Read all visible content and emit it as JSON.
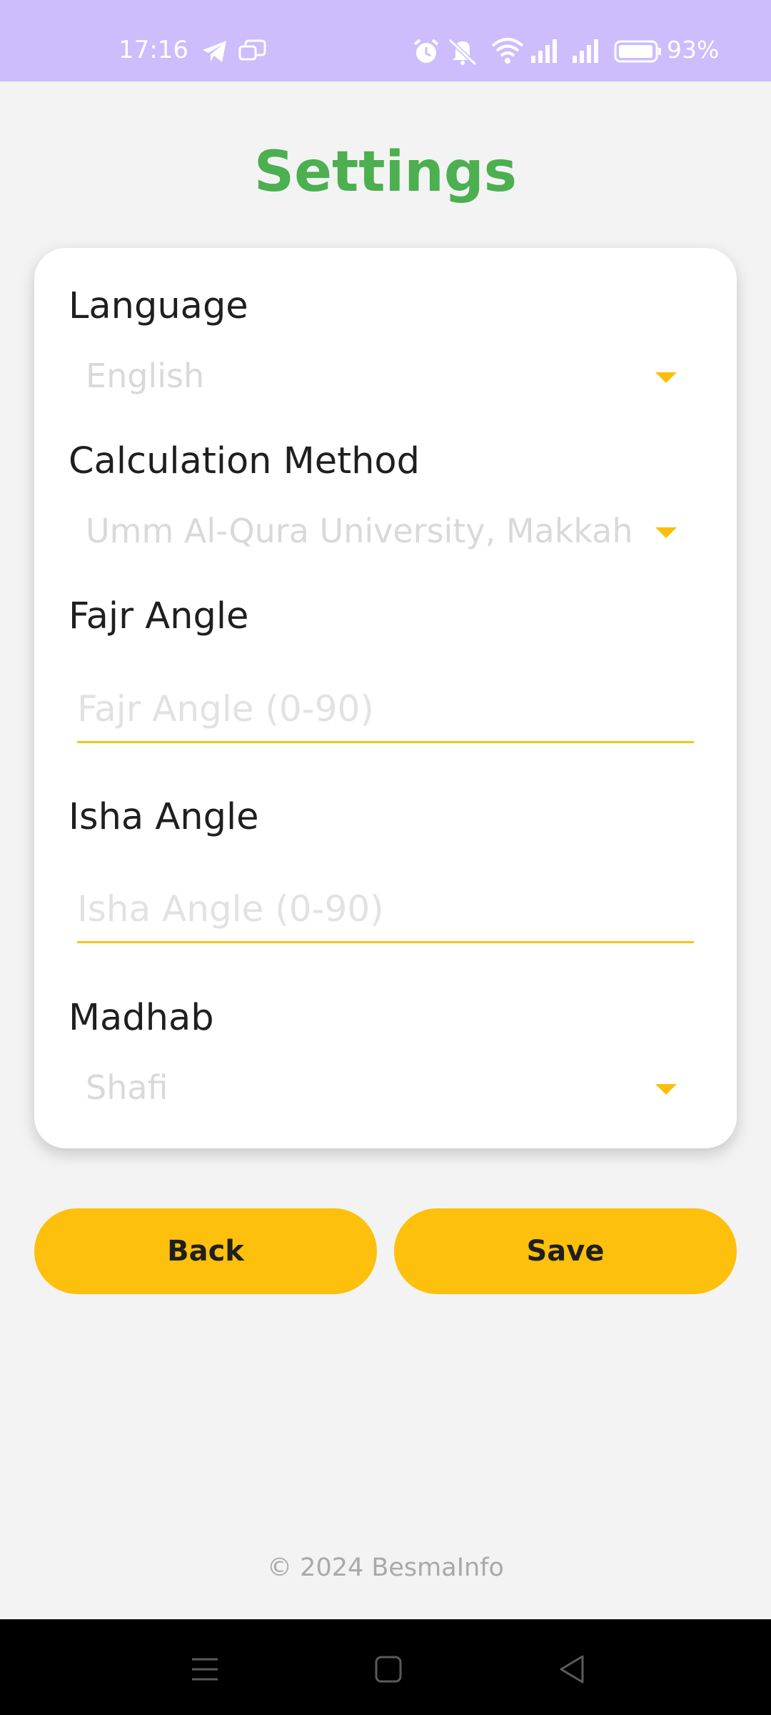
{
  "status_bar": {
    "time": "17:16",
    "battery": "93%",
    "icons": [
      "telegram-icon",
      "message-icon",
      "alarm-icon",
      "mute-icon",
      "wifi-icon",
      "signal-icon",
      "signal-icon-2",
      "battery-icon"
    ]
  },
  "page": {
    "title": "Settings"
  },
  "settings": {
    "language": {
      "label": "Language",
      "value": "English"
    },
    "calculation_method": {
      "label": "Calculation Method",
      "value": "Umm Al-Qura University, Makkah"
    },
    "fajr_angle": {
      "label": "Fajr Angle",
      "placeholder": "Fajr Angle (0-90)",
      "value": ""
    },
    "isha_angle": {
      "label": "Isha Angle",
      "placeholder": "Isha Angle (0-90)",
      "value": ""
    },
    "madhab": {
      "label": "Madhab",
      "value": "Shafi"
    }
  },
  "buttons": {
    "back": "Back",
    "save": "Save"
  },
  "footer": {
    "copyright": "© 2024 BesmaInfo"
  },
  "colors": {
    "status_bar": "#cdbdfc",
    "title": "#4caf50",
    "accent": "#fdc00c",
    "background": "#f3f3f3"
  },
  "nav_bar": {
    "icons": [
      "menu-icon",
      "home-icon",
      "back-icon"
    ]
  }
}
